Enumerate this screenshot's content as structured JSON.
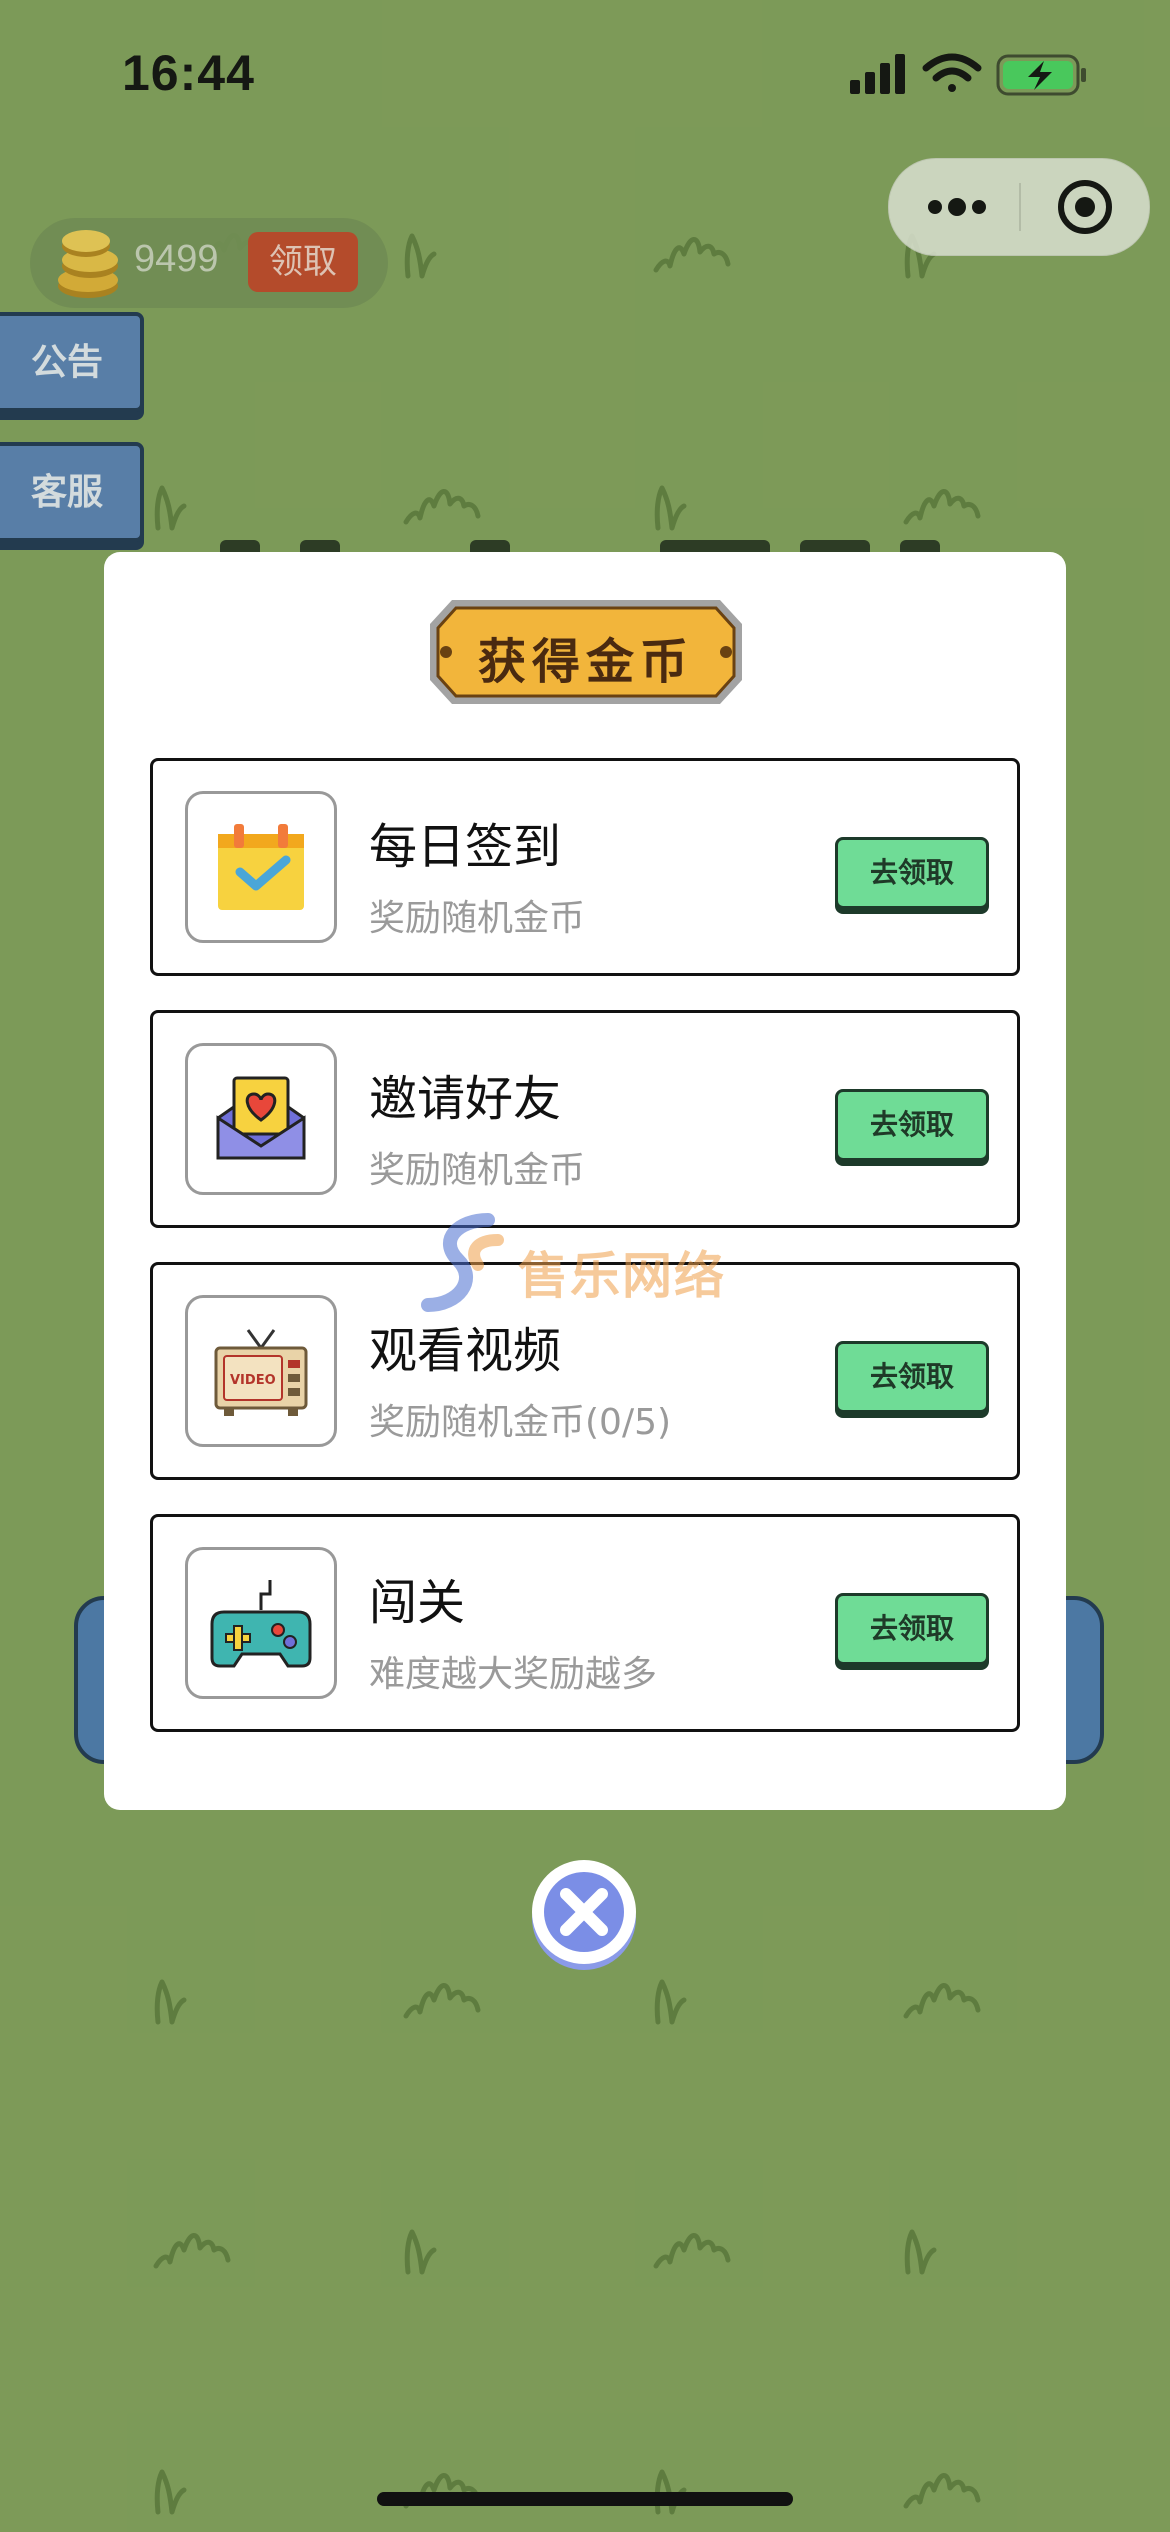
{
  "status_bar": {
    "time": "16:44"
  },
  "coins": {
    "count": "9499",
    "claim_label": "领取"
  },
  "side_buttons": {
    "notice": "公告",
    "service": "客服"
  },
  "modal": {
    "title": "获得金币",
    "items": [
      {
        "title": "每日签到",
        "subtitle": "奖励随机金币",
        "button": "去领取",
        "icon": "calendar-check-icon"
      },
      {
        "title": "邀请好友",
        "subtitle": "奖励随机金币",
        "button": "去领取",
        "icon": "heart-envelope-icon"
      },
      {
        "title": "观看视频",
        "subtitle": "奖励随机金币(0/5)",
        "button": "去领取",
        "icon": "tv-video-icon"
      },
      {
        "title": "闯关",
        "subtitle": "难度越大奖励越多",
        "button": "去领取",
        "icon": "gamepad-icon"
      }
    ]
  },
  "watermark": {
    "text": "售乐网络"
  },
  "icons": {
    "signal": "cellular-signal-icon",
    "wifi": "wifi-icon",
    "battery": "battery-charging-icon",
    "more": "more-dots-icon",
    "target": "mini-program-close-icon",
    "coin": "coin-stack-icon",
    "close": "close-circle-icon"
  },
  "colors": {
    "background": "#86a45f",
    "button_green": "#6fdc96",
    "banner_gold": "#f2b53b",
    "claim_red": "#c54a2c",
    "side_blue": "#5d85b9",
    "battery_green": "#4cd964"
  }
}
